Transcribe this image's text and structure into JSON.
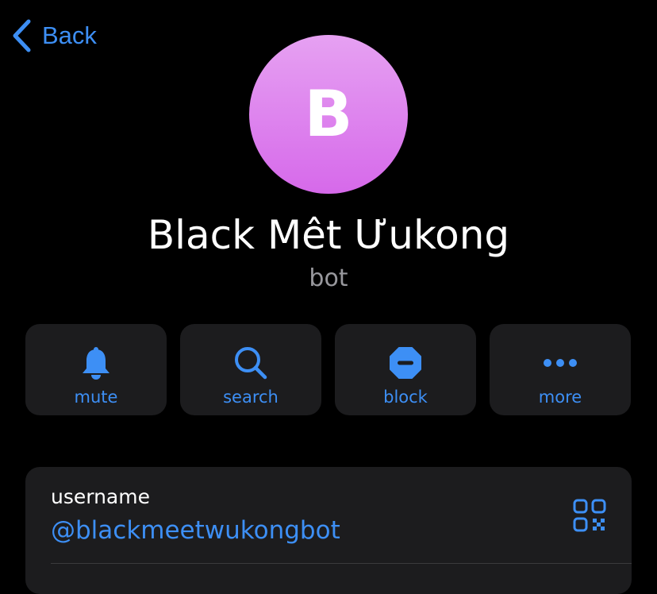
{
  "nav": {
    "back_label": "Back"
  },
  "profile": {
    "avatar_letter": "B",
    "name": "Black Mêt Ưukong",
    "subtitle": "bot"
  },
  "actions": [
    {
      "label": "mute",
      "icon": "bell-icon"
    },
    {
      "label": "search",
      "icon": "search-icon"
    },
    {
      "label": "block",
      "icon": "block-icon"
    },
    {
      "label": "more",
      "icon": "more-icon"
    }
  ],
  "info": {
    "username_label": "username",
    "username_value": "@blackmeetwukongbot"
  },
  "colors": {
    "accent": "#3d8ff5",
    "background": "#000000",
    "card": "#1c1c1e",
    "secondary_text": "#98989d",
    "avatar_top": "#e6a1f2",
    "avatar_bottom": "#d669ea"
  }
}
